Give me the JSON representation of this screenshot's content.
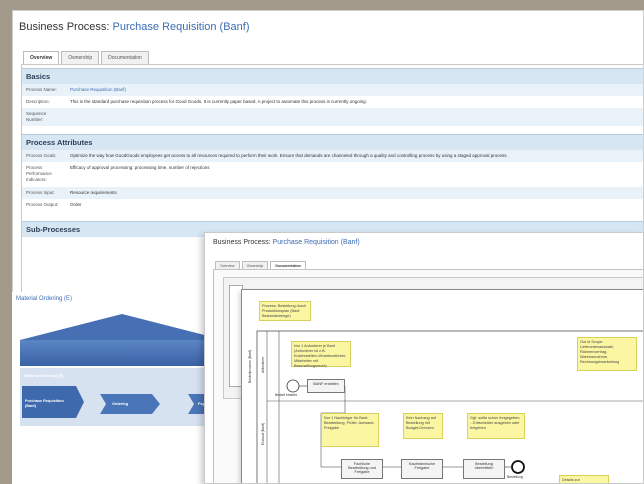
{
  "main_window": {
    "title_prefix": "Business Process:",
    "title_link": "Purchase Requisition (Banf)",
    "tabs": [
      "Overview",
      "Ownership",
      "Documentation"
    ],
    "basics": {
      "header": "Basics",
      "rows": [
        {
          "key": "Process Name:",
          "value": "Purchase Requisition (Banf)"
        },
        {
          "key": "Description:",
          "value": "This is the standard purchase requisition process for Good Goods. It is currently paper based. A project to automate this process is currently ongoing."
        },
        {
          "key": "Sequence Number:",
          "value": ""
        }
      ]
    },
    "attributes": {
      "header": "Process Attributes",
      "rows": [
        {
          "key": "Process Goals:",
          "value": "Optimize the way how GoodGoods employees get access to all resources required to perform their work. Ensure that demands are channeled through a quality and controlling process by using a staged approval process."
        },
        {
          "key": "Process Performance Indicators:",
          "value": "Efficacy of approval processing: processing time, number of rejections"
        },
        {
          "key": "Process Input:",
          "value": "Resource requirements"
        },
        {
          "key": "Process Output:",
          "value": "Order"
        }
      ]
    },
    "subprocesses": {
      "header": "Sub-Processes"
    }
  },
  "value_chain": {
    "title": "Material Ordering (E)",
    "band_label": "Material Ordering (E)",
    "steps": [
      "Purchase Requisition (Banf)",
      "Ordering",
      "Paym"
    ]
  },
  "second_window": {
    "title_prefix": "Business Process:",
    "title_link": "Purchase Requisition (Banf)",
    "tabs": [
      "Overview",
      "Ownership",
      "Documentation"
    ],
    "note_top": "Prozess: Bestellung durch Produktionsplan (Banf, Bestandsmenge)",
    "note_a": "Nur 1 Anforderer je Banf (Anforderer ist z.B. Kostenstellen-Verantwortlicher, Mitarbeiter mit Beschaffungsrecht)",
    "note_b": "Nur 1 Nachfolger für Banf-Bearbeitung, Prüfer, Aufwand, Freigabe",
    "note_c": "Kein Nachzug auf Bestellung mit Budget-Grenzen",
    "note_d": "Ggf. sollte schon freigegeben, ...Entscheider ausgeben oder freigeben",
    "note_e": "Out of Scope: Lieferantenauswahl, Rahmenvertrag, Warenannahme, Rechnungsbearbeitung",
    "note_f": "Details zur Rechnungsprüfung",
    "lane_1": "Anforderer",
    "lane_2": "Einkauf (Banf)",
    "lane_pool": "Bestellprozess (Banf)",
    "start_label": "Bedarf besteht",
    "task_1": "BANF erstellen",
    "task_2": "Fachliche Bearbeitung und Freigabe",
    "task_3": "Kaufmännische Freigabe",
    "task_4": "Bestellung übermitteln",
    "end_label": "Bestellung"
  }
}
